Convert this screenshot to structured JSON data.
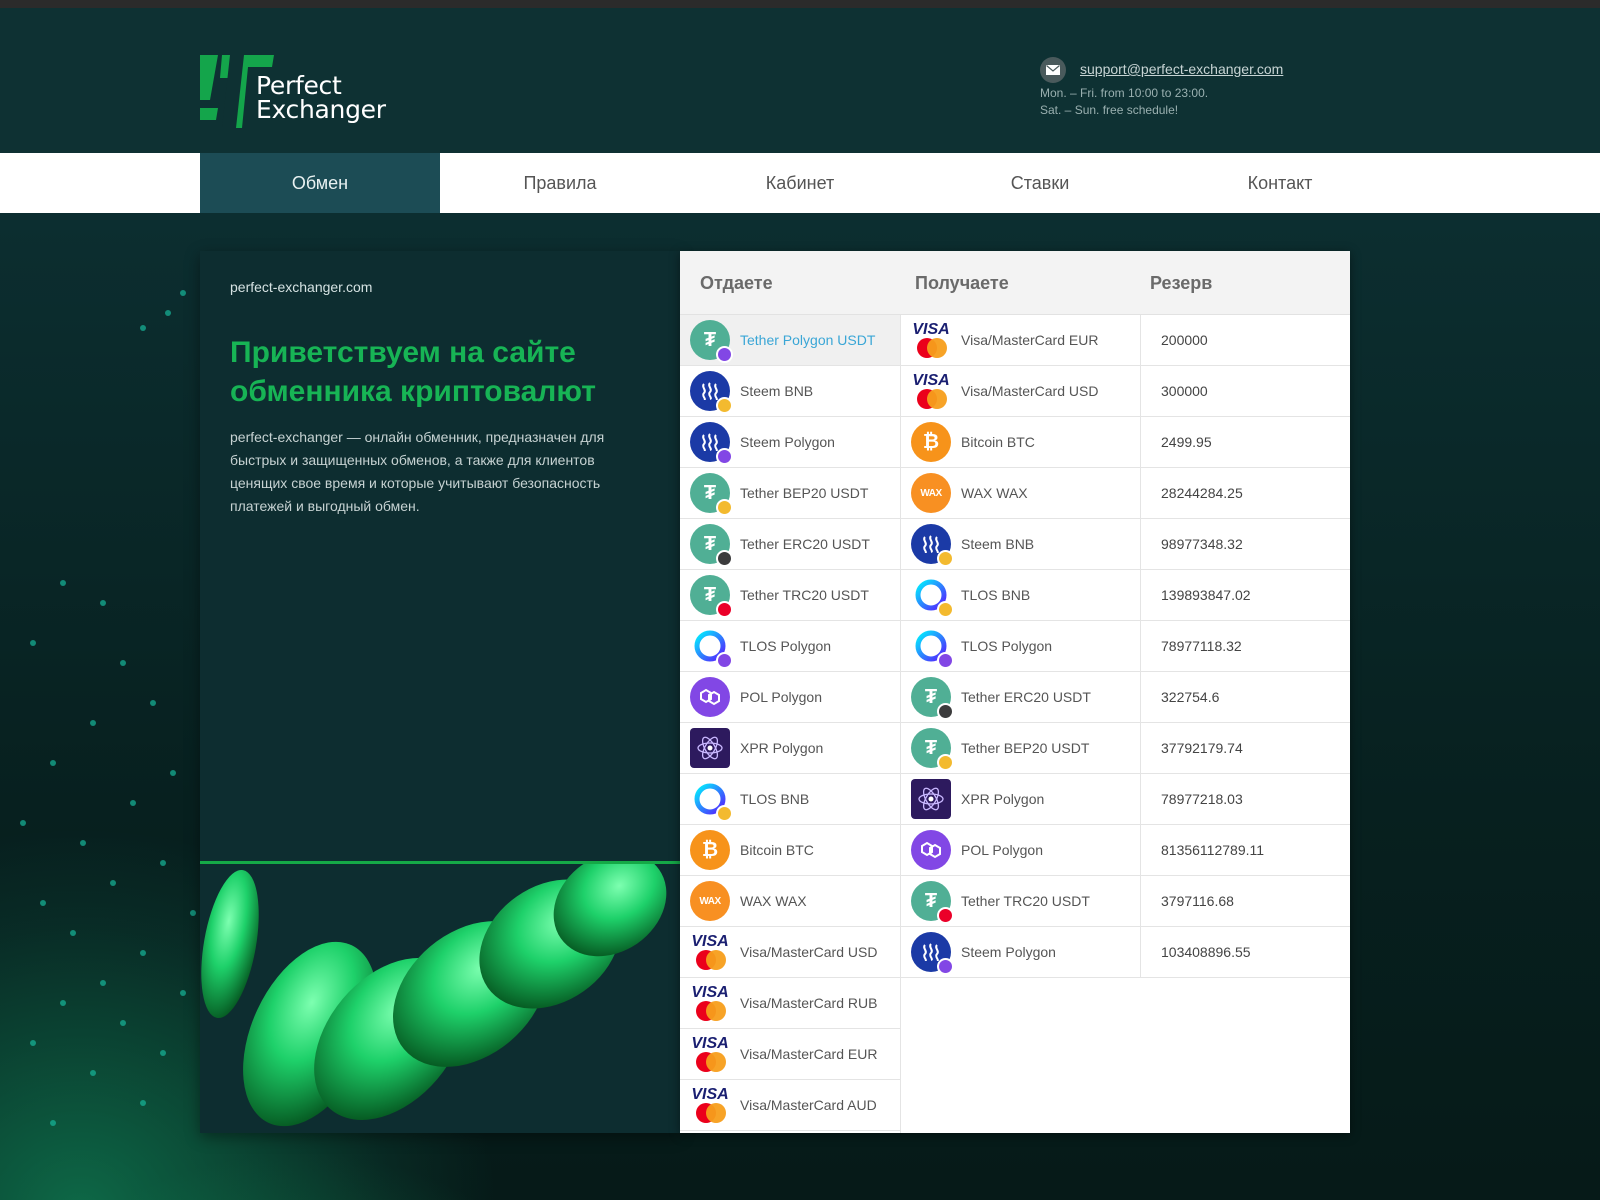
{
  "header": {
    "logo_line1": "Perfect",
    "logo_line2": "Exchanger",
    "support_email": "support@perfect-exchanger.com",
    "hours_line1": "Mon. – Fri. from 10:00 to 23:00.",
    "hours_line2": "Sat. – Sun. free schedule!"
  },
  "nav": {
    "items": [
      {
        "label": "Обмен",
        "active": true
      },
      {
        "label": "Правила",
        "active": false
      },
      {
        "label": "Кабинет",
        "active": false
      },
      {
        "label": "Ставки",
        "active": false
      },
      {
        "label": "Контакт",
        "active": false
      }
    ]
  },
  "intro": {
    "site": "perfect-exchanger.com",
    "title": "Приветствуем на сайте обменника криптовалют",
    "description": "perfect-exchanger — онлайн обменник, предназначен для быстрых и защищенных обменов, а также для клиентов ценящих свое время и которые учитывают безопасность платежей и выгодный обмен."
  },
  "table": {
    "headers": {
      "give": "Отдаете",
      "get": "Получаете",
      "reserve": "Резерв"
    },
    "give": [
      {
        "label": "Tether Polygon USDT",
        "icon": "usdt",
        "badge": "polygon",
        "active": true
      },
      {
        "label": "Steem BNB",
        "icon": "steem",
        "badge": "bnb"
      },
      {
        "label": "Steem Polygon",
        "icon": "steem",
        "badge": "polygon"
      },
      {
        "label": "Tether BEP20 USDT",
        "icon": "usdt",
        "badge": "bnb"
      },
      {
        "label": "Tether ERC20 USDT",
        "icon": "usdt",
        "badge": "eth"
      },
      {
        "label": "Tether TRC20 USDT",
        "icon": "usdt",
        "badge": "trx"
      },
      {
        "label": "TLOS Polygon",
        "icon": "tlos",
        "badge": "polygon"
      },
      {
        "label": "POL Polygon",
        "icon": "pol",
        "badge": ""
      },
      {
        "label": "XPR Polygon",
        "icon": "xpr",
        "badge": ""
      },
      {
        "label": "TLOS BNB",
        "icon": "tlos",
        "badge": "bnb"
      },
      {
        "label": "Bitcoin BTC",
        "icon": "btc",
        "badge": ""
      },
      {
        "label": "WAX WAX",
        "icon": "wax",
        "badge": ""
      },
      {
        "label": "Visa/MasterCard USD",
        "icon": "visa",
        "badge": ""
      },
      {
        "label": "Visa/MasterCard RUB",
        "icon": "visa",
        "badge": ""
      },
      {
        "label": "Visa/MasterCard EUR",
        "icon": "visa",
        "badge": ""
      },
      {
        "label": "Visa/MasterCard AUD",
        "icon": "visa",
        "badge": ""
      }
    ],
    "get": [
      {
        "label": "Visa/MasterCard EUR",
        "icon": "visa",
        "badge": "",
        "reserve": "200000"
      },
      {
        "label": "Visa/MasterCard USD",
        "icon": "visa",
        "badge": "",
        "reserve": "300000"
      },
      {
        "label": "Bitcoin BTC",
        "icon": "btc",
        "badge": "",
        "reserve": "2499.95"
      },
      {
        "label": "WAX WAX",
        "icon": "wax",
        "badge": "",
        "reserve": "28244284.25"
      },
      {
        "label": "Steem BNB",
        "icon": "steem",
        "badge": "bnb",
        "reserve": "98977348.32"
      },
      {
        "label": "TLOS BNB",
        "icon": "tlos",
        "badge": "bnb",
        "reserve": "139893847.02"
      },
      {
        "label": "TLOS Polygon",
        "icon": "tlos",
        "badge": "polygon",
        "reserve": "78977118.32"
      },
      {
        "label": "Tether ERC20 USDT",
        "icon": "usdt",
        "badge": "eth",
        "reserve": "322754.6"
      },
      {
        "label": "Tether BEP20 USDT",
        "icon": "usdt",
        "badge": "bnb",
        "reserve": "37792179.74"
      },
      {
        "label": "XPR Polygon",
        "icon": "xpr",
        "badge": "",
        "reserve": "78977218.03"
      },
      {
        "label": "POL Polygon",
        "icon": "pol",
        "badge": "",
        "reserve": "81356112789.11"
      },
      {
        "label": "Tether TRC20 USDT",
        "icon": "usdt",
        "badge": "trx",
        "reserve": "3797116.68"
      },
      {
        "label": "Steem Polygon",
        "icon": "steem",
        "badge": "polygon",
        "reserve": "103408896.55"
      }
    ]
  },
  "colors": {
    "accent_green": "#17b455",
    "nav_active": "#1c4c55",
    "link_blue": "#3aa6d6"
  }
}
